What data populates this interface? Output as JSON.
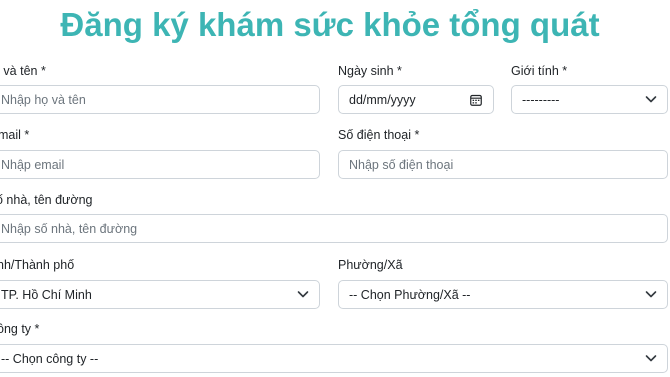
{
  "form": {
    "title": "Đăng ký khám sức khỏe tổng quát",
    "full_name": {
      "label": "ọ và tên *",
      "placeholder": "Nhập họ và tên"
    },
    "dob": {
      "label": "Ngày sinh *",
      "value": "dd/mm/yyyy"
    },
    "gender": {
      "label": "Giới tính *",
      "value": "---------"
    },
    "email": {
      "label": "mail *",
      "placeholder": "Nhập email"
    },
    "phone": {
      "label": "Số điện thoại *",
      "placeholder": "Nhập số điện thoại"
    },
    "address": {
      "label": "ố nhà, tên đường",
      "placeholder": "Nhập số nhà, tên đường"
    },
    "province": {
      "label": "nh/Thành phố",
      "value": "TP. Hồ Chí Minh"
    },
    "ward": {
      "label": "Phường/Xã",
      "value": "-- Chọn Phường/Xã --"
    },
    "company": {
      "label": "ông ty *",
      "value": "-- Chọn công ty --"
    }
  },
  "icons": {
    "dropdown": "chevron-down-icon",
    "date": "calendar-icon"
  }
}
